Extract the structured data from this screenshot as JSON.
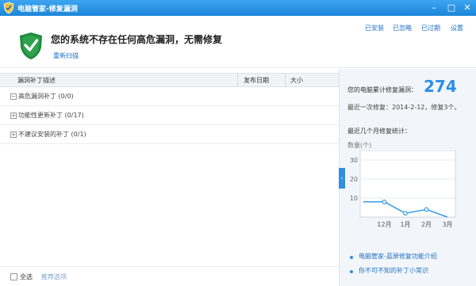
{
  "window": {
    "title": "电脑管家-修复漏洞"
  },
  "header": {
    "status_message": "您的系统不存在任何高危漏洞，无需修复",
    "rescan_label": "重新扫描",
    "links": [
      "已安装",
      "已忽略",
      "已过期",
      "设置"
    ]
  },
  "table": {
    "columns": [
      "漏洞补丁描述",
      "发布日期",
      "大小"
    ],
    "groups": [
      "高危漏洞补丁 (0/0)",
      "功能性更新补丁 (0/17)",
      "不建议安装的补丁 (0/1)"
    ]
  },
  "footer": {
    "select_all_label": "全选",
    "recommend_label": "推荐选项"
  },
  "side": {
    "count_label": "您的电脑累计修复漏洞：",
    "count_value": "274",
    "last_fix": "最近一次修复：2014-2-12，修复3个。",
    "stats_label": "最近几个月修复统计：",
    "unit_label": "数量(个)",
    "links": [
      "电脑管家-蓝屏修复功能介绍",
      "你不可不知的补丁小常识"
    ]
  },
  "chart_data": {
    "type": "line",
    "categories": [
      "",
      "12月",
      "1月",
      "2月",
      "3月"
    ],
    "values": [
      8,
      8,
      2,
      4,
      0
    ],
    "ylabel": "数量(个)",
    "ylim": [
      0,
      35
    ],
    "yticks": [
      10,
      20,
      30
    ],
    "grid": true
  },
  "colors": {
    "accent": "#2b8fe6",
    "titlebar": "#1a86d9",
    "shield": "#1f8a3b"
  }
}
